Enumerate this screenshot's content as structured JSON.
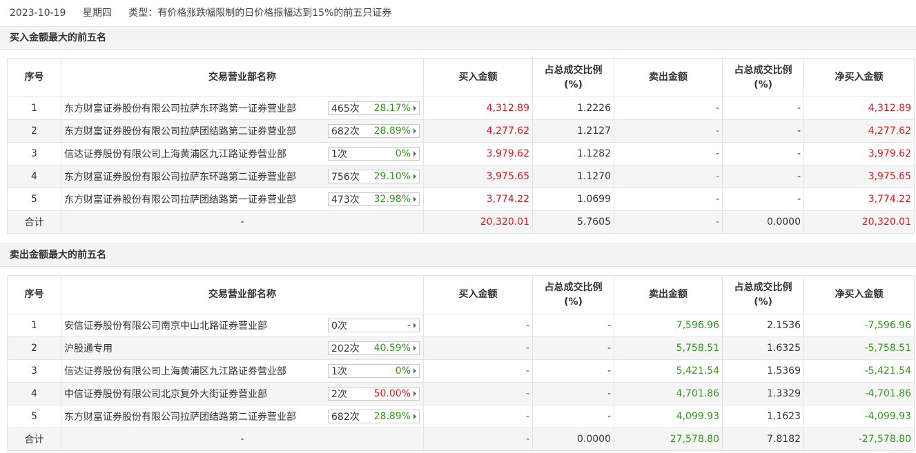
{
  "header": {
    "date": "2023-10-19",
    "weekday": "星期四",
    "type_text": "类型：有价格涨跌幅限制的日价格振幅达到15%的前五只证券"
  },
  "columns": {
    "index": "序号",
    "broker": "交易营业部名称",
    "buy": "买入金额",
    "ratio1_l1": "占总成交比例",
    "ratio1_l2": "(%)",
    "sell": "卖出金额",
    "ratio2_l1": "占总成交比例",
    "ratio2_l2": "(%)",
    "net": "净买入金额"
  },
  "colors": {
    "up": "#e4161c",
    "down": "#2f9a18"
  },
  "buy_section": {
    "title": "买入金额最大的前五名",
    "rows": [
      {
        "idx": "1",
        "name": "东方财富证券股份有限公司拉萨东环路第一证券营业部",
        "count": "465次",
        "pct": "28.17%",
        "buy": "4,312.89",
        "buy_ratio": "1.2226",
        "sell": "-",
        "sell_ratio": "-",
        "net": "4,312.89"
      },
      {
        "idx": "2",
        "name": "东方财富证券股份有限公司拉萨团结路第二证券营业部",
        "count": "682次",
        "pct": "28.89%",
        "buy": "4,277.62",
        "buy_ratio": "1.2127",
        "sell": "-",
        "sell_ratio": "-",
        "net": "4,277.62"
      },
      {
        "idx": "3",
        "name": "信达证券股份有限公司上海黄浦区九江路证券营业部",
        "count": "1次",
        "pct": "0%",
        "buy": "3,979.62",
        "buy_ratio": "1.1282",
        "sell": "-",
        "sell_ratio": "-",
        "net": "3,979.62"
      },
      {
        "idx": "4",
        "name": "东方财富证券股份有限公司拉萨东环路第二证券营业部",
        "count": "756次",
        "pct": "29.10%",
        "buy": "3,975.65",
        "buy_ratio": "1.1270",
        "sell": "-",
        "sell_ratio": "-",
        "net": "3,975.65"
      },
      {
        "idx": "5",
        "name": "东方财富证券股份有限公司拉萨团结路第一证券营业部",
        "count": "473次",
        "pct": "32.98%",
        "buy": "3,774.22",
        "buy_ratio": "1.0699",
        "sell": "-",
        "sell_ratio": "-",
        "net": "3,774.22"
      }
    ],
    "total": {
      "label": "合计",
      "name": "-",
      "buy": "20,320.01",
      "buy_ratio": "5.7605",
      "sell": "-",
      "sell_ratio": "0.0000",
      "net": "20,320.01"
    }
  },
  "sell_section": {
    "title": "卖出金额最大的前五名",
    "rows": [
      {
        "idx": "1",
        "name": "安信证券股份有限公司南京中山北路证券营业部",
        "count": "0次",
        "pct": "-",
        "buy": "-",
        "buy_ratio": "-",
        "sell": "7,596.96",
        "sell_ratio": "2.1536",
        "net": "-7,596.96"
      },
      {
        "idx": "2",
        "name": "沪股通专用",
        "count": "202次",
        "pct": "40.59%",
        "buy": "-",
        "buy_ratio": "-",
        "sell": "5,758.51",
        "sell_ratio": "1.6325",
        "net": "-5,758.51"
      },
      {
        "idx": "3",
        "name": "信达证券股份有限公司上海黄浦区九江路证券营业部",
        "count": "1次",
        "pct": "0%",
        "buy": "-",
        "buy_ratio": "-",
        "sell": "5,421.54",
        "sell_ratio": "1.5369",
        "net": "-5,421.54"
      },
      {
        "idx": "4",
        "name": "中信证券股份有限公司北京复外大街证券营业部",
        "count": "2次",
        "pct": "50.00%",
        "buy": "-",
        "buy_ratio": "-",
        "sell": "4,701.86",
        "sell_ratio": "1.3329",
        "net": "-4,701.86"
      },
      {
        "idx": "5",
        "name": "东方财富证券股份有限公司拉萨团结路第二证券营业部",
        "count": "682次",
        "pct": "28.89%",
        "buy": "-",
        "buy_ratio": "-",
        "sell": "4,099.93",
        "sell_ratio": "1.1623",
        "net": "-4,099.93"
      }
    ],
    "total": {
      "label": "合计",
      "name": "-",
      "buy": "-",
      "buy_ratio": "0.0000",
      "sell": "27,578.80",
      "sell_ratio": "7.8182",
      "net": "-27,578.80"
    }
  }
}
